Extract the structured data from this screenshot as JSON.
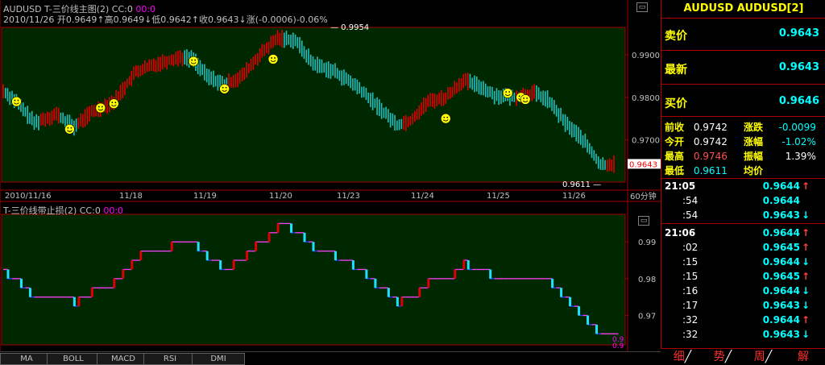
{
  "main_chart": {
    "title": "AUDUSD T-三价线主图(2) CC:0",
    "title_extra": "00:0",
    "ohlc": "2010/11/26 开0.9649↑高0.9649↓低0.9642↑收0.9643↓涨(-0.0006)-0.06%",
    "peak_label": "0.9954",
    "low_label": "0.9611",
    "current_price_label": "0.9643",
    "y_ticks": [
      "0.9900",
      "0.9800",
      "0.9700"
    ],
    "x_ticks": [
      "2010/11/16",
      "11/18",
      "11/19",
      "11/20",
      "11/23",
      "11/24",
      "11/25",
      "11/26"
    ],
    "period": "60分钟",
    "colors": {
      "up": "#e00000",
      "down": "#20c0c0",
      "bg": "#002800",
      "marker": "#ffff00"
    }
  },
  "sub_chart": {
    "title": "T-三价线带止损(2) CC:0",
    "title_extra": "00:0",
    "y_ticks": [
      "0.99",
      "0.98",
      "0.97"
    ],
    "edge_labels": [
      "0.9",
      "0.9"
    ]
  },
  "indicator_tabs": [
    "MA",
    "BOLL",
    "MACD",
    "RSI",
    "DMI"
  ],
  "side": {
    "symbol": "AUDUSD AUDUSD[2]",
    "sell_label": "卖价",
    "sell": "0.9643",
    "last_label": "最新",
    "last": "0.9643",
    "buy_label": "买价",
    "buy": "0.9646",
    "stats": {
      "prev_close_label": "前收",
      "prev_close": "0.9742",
      "change_label": "涨跌",
      "change": "-0.0099",
      "open_label": "今开",
      "open": "0.9742",
      "change_pct_label": "涨幅",
      "change_pct": "-1.02%",
      "high_label": "最高",
      "high": "0.9746",
      "amplitude_label": "振幅",
      "amplitude": "1.39%",
      "low_label": "最低",
      "low": "0.9611",
      "avg_label": "均价",
      "avg": ""
    },
    "ticks": [
      {
        "time": "21:05",
        "price": "0.9644",
        "dir": "up"
      },
      {
        "time": ":54",
        "price": "0.9644",
        "dir": ""
      },
      {
        "time": ":54",
        "price": "0.9643",
        "dir": "down"
      },
      {
        "time": "21:06",
        "price": "0.9644",
        "dir": "up"
      },
      {
        "time": ":02",
        "price": "0.9645",
        "dir": "up"
      },
      {
        "time": ":15",
        "price": "0.9644",
        "dir": "down"
      },
      {
        "time": ":15",
        "price": "0.9645",
        "dir": "up"
      },
      {
        "time": ":16",
        "price": "0.9644",
        "dir": "down"
      },
      {
        "time": ":17",
        "price": "0.9643",
        "dir": "down"
      },
      {
        "time": ":32",
        "price": "0.9644",
        "dir": "up"
      },
      {
        "time": ":32",
        "price": "0.9643",
        "dir": "down"
      }
    ],
    "tabs": [
      "细",
      "势",
      "周",
      "解"
    ]
  }
}
